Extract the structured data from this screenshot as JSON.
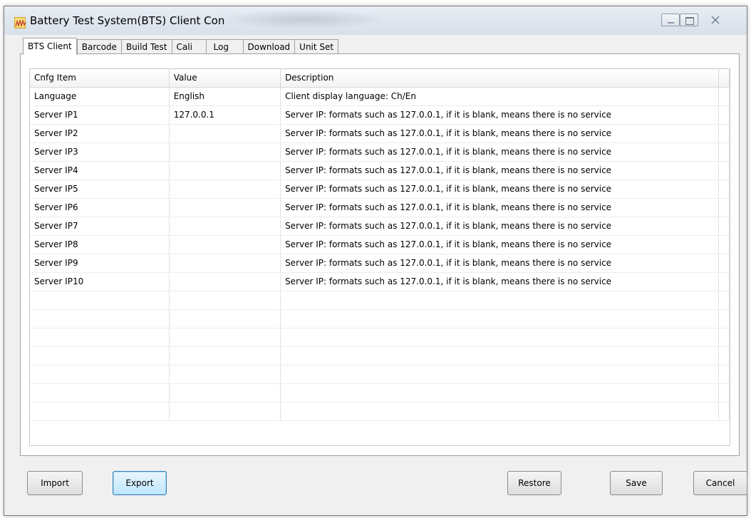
{
  "window": {
    "title": "Battery Test System(BTS) Client Con",
    "icon": "waveform-app-icon",
    "controls": [
      "minimize-icon",
      "maximize-icon",
      "close-icon"
    ]
  },
  "tabs": [
    {
      "label": "BTS Client",
      "active": true
    },
    {
      "label": "Barcode",
      "active": false
    },
    {
      "label": "Build Test",
      "active": false
    },
    {
      "label": "Cali",
      "active": false
    },
    {
      "label": "Log",
      "active": false
    },
    {
      "label": "Download",
      "active": false
    },
    {
      "label": "Unit Set",
      "active": false
    }
  ],
  "grid": {
    "columns": [
      "Cnfg Item",
      "Value",
      "Description"
    ],
    "rows": [
      [
        "Language",
        "English",
        "Client display language: Ch/En"
      ],
      [
        "Server IP1",
        "127.0.0.1",
        "Server IP: formats such as 127.0.0.1, if it is blank, means there is no service"
      ],
      [
        "Server IP2",
        "",
        "Server IP: formats such as 127.0.0.1, if it is blank, means there is no service"
      ],
      [
        "Server IP3",
        "",
        "Server IP: formats such as 127.0.0.1, if it is blank, means there is no service"
      ],
      [
        "Server IP4",
        "",
        "Server IP: formats such as 127.0.0.1, if it is blank, means there is no service"
      ],
      [
        "Server IP5",
        "",
        "Server IP: formats such as 127.0.0.1, if it is blank, means there is no service"
      ],
      [
        "Server IP6",
        "",
        "Server IP: formats such as 127.0.0.1, if it is blank, means there is no service"
      ],
      [
        "Server IP7",
        "",
        "Server IP: formats such as 127.0.0.1, if it is blank, means there is no service"
      ],
      [
        "Server IP8",
        "",
        "Server IP: formats such as 127.0.0.1, if it is blank, means there is no service"
      ],
      [
        "Server IP9",
        "",
        "Server IP: formats such as 127.0.0.1, if it is blank, means there is no service"
      ],
      [
        "Server IP10",
        "",
        "Server IP: formats such as 127.0.0.1, if it is blank, means there is no service"
      ]
    ]
  },
  "buttons": {
    "import_label": "Import",
    "export_label": "Export",
    "restore_label": "Restore",
    "save_label": "Save",
    "cancel_label": "Cancel"
  },
  "colors": {
    "focus_button_border": "#3c7fb1",
    "focus_button_fill": "#bee6fd",
    "titlebar": "#dfe6ef"
  }
}
